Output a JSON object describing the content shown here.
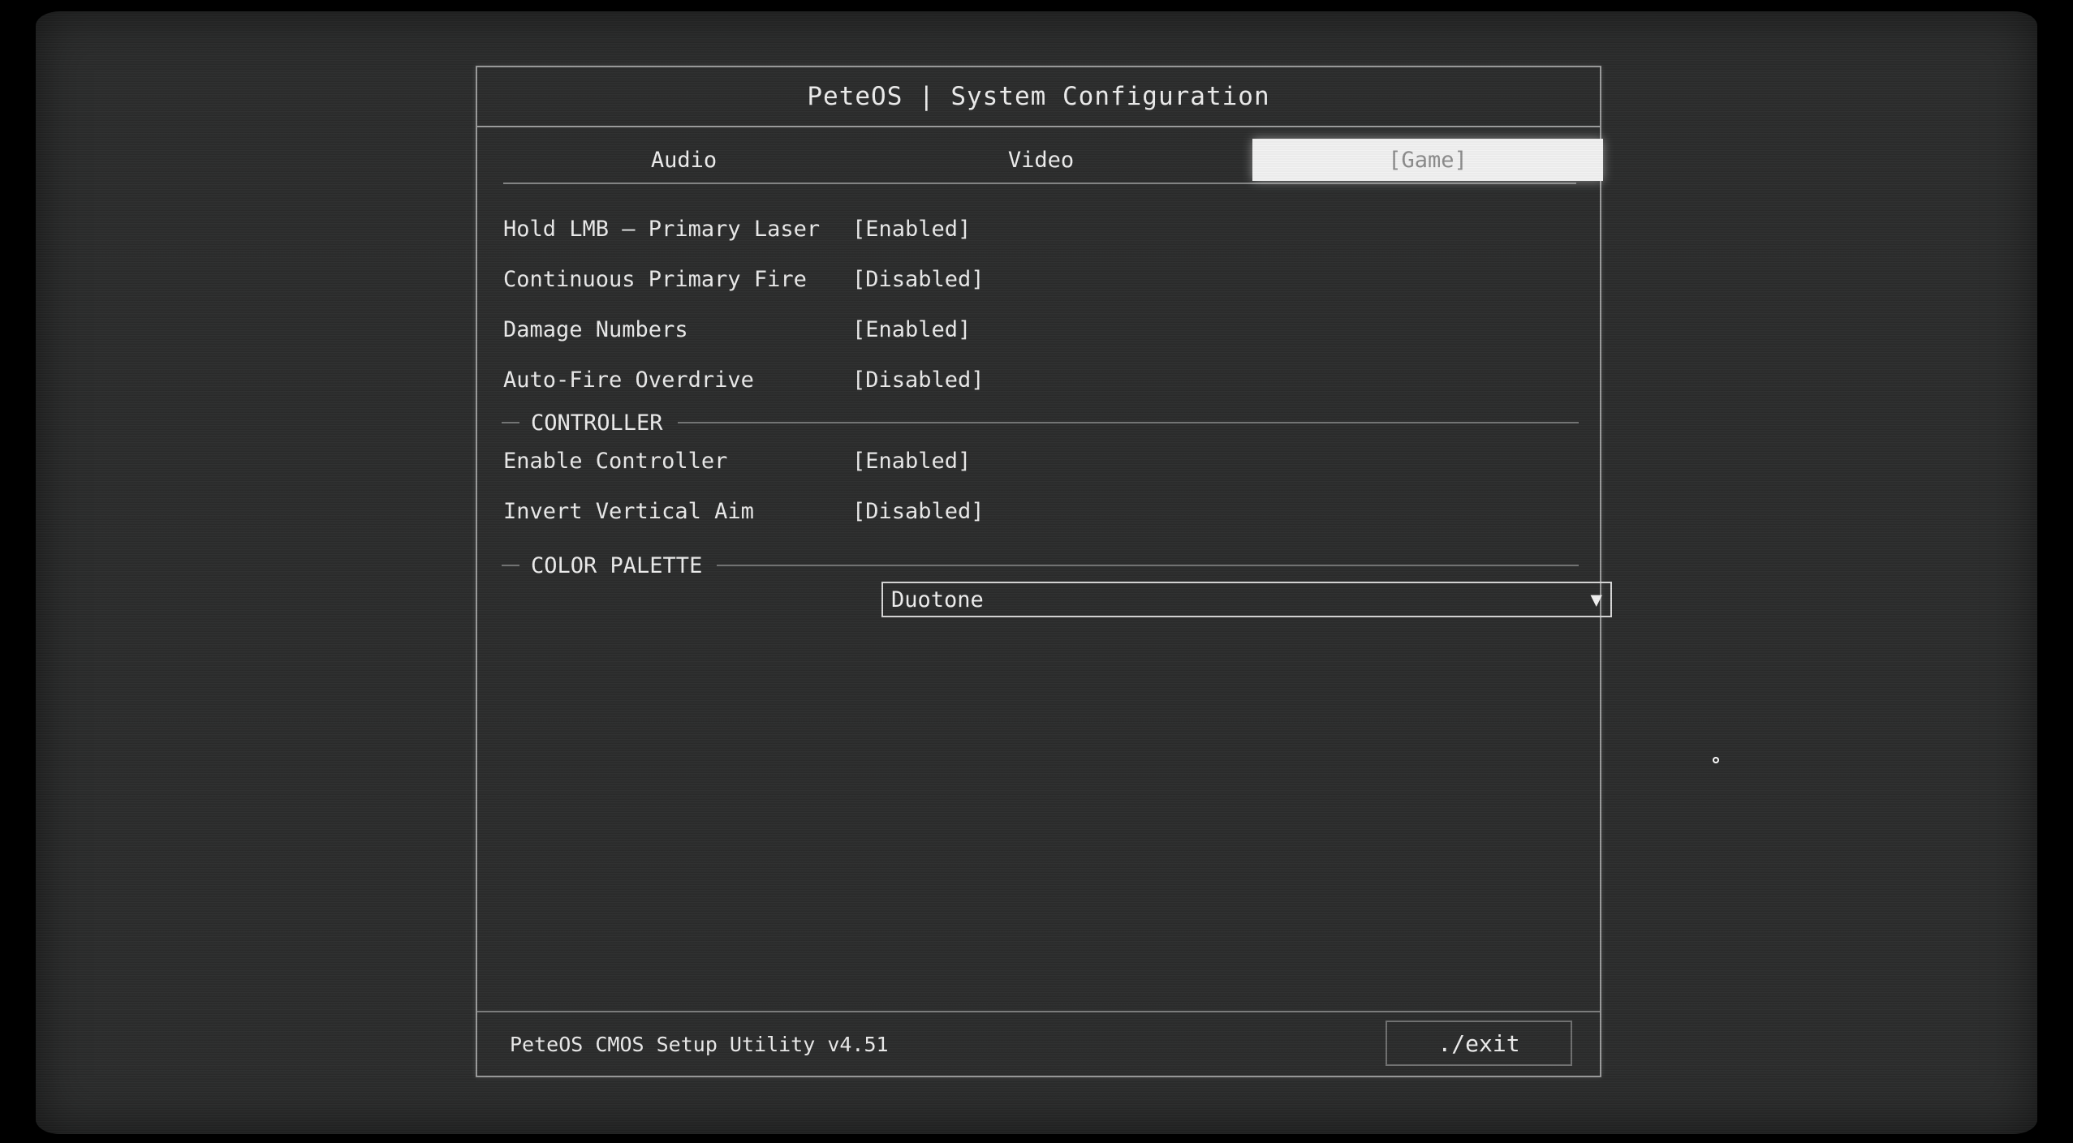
{
  "window": {
    "title": "PeteOS | System Configuration"
  },
  "tabs": [
    {
      "label": "Audio",
      "active": false
    },
    {
      "label": "Video",
      "active": false
    },
    {
      "label": "[Game]",
      "active": true
    }
  ],
  "settings": [
    {
      "label": "Hold LMB — Primary Laser",
      "value": "[Enabled]"
    },
    {
      "label": "Continuous Primary Fire",
      "value": "[Disabled]"
    },
    {
      "label": "Damage Numbers",
      "value": "[Enabled]"
    },
    {
      "label": "Auto-Fire Overdrive",
      "value": "[Disabled]"
    }
  ],
  "controller": {
    "heading": "CONTROLLER",
    "settings": [
      {
        "label": "Enable Controller",
        "value": "[Enabled]"
      },
      {
        "label": "Invert Vertical Aim",
        "value": "[Disabled]"
      }
    ]
  },
  "color_palette": {
    "heading": "COLOR PALETTE",
    "selected": "Duotone",
    "arrow": "▼"
  },
  "footer": {
    "version": "PeteOS CMOS Setup Utility v4.51",
    "exit_label": "./exit"
  },
  "colors": {
    "screen_bg": "#2b2c2c",
    "border": "#9a9b9b",
    "active_tab_bg": "#f2f2f2",
    "active_tab_text": "#8c8c8c",
    "text": "#eaeaea"
  }
}
